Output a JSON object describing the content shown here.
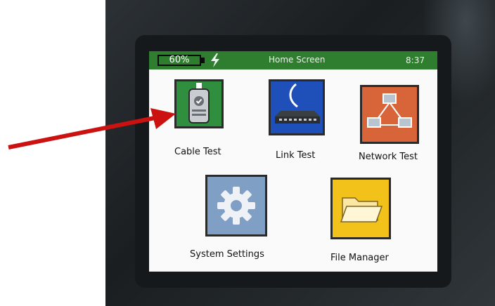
{
  "status_bar": {
    "battery_percent": "60%",
    "title": "Home Screen",
    "time": "8:37",
    "accent_color": "#2f7d2f"
  },
  "apps": [
    {
      "id": "cable_test",
      "label": "Cable Test",
      "icon": "cable-tester-icon",
      "tile_color": "#2f8f3f",
      "selected": true
    },
    {
      "id": "link_test",
      "label": "Link Test",
      "icon": "network-switch-icon",
      "tile_color": "#1f4fb8"
    },
    {
      "id": "network_test",
      "label": "Network Test",
      "icon": "network-topology-icon",
      "tile_color": "#d8643a"
    },
    {
      "id": "system_settings",
      "label": "System Settings",
      "icon": "gear-icon",
      "tile_color": "#7f9fc4"
    },
    {
      "id": "file_manager",
      "label": "File Manager",
      "icon": "folder-icon",
      "tile_color": "#f3c21a"
    }
  ],
  "annotation": {
    "icon": "red-arrow-icon",
    "color": "#cc1111"
  }
}
